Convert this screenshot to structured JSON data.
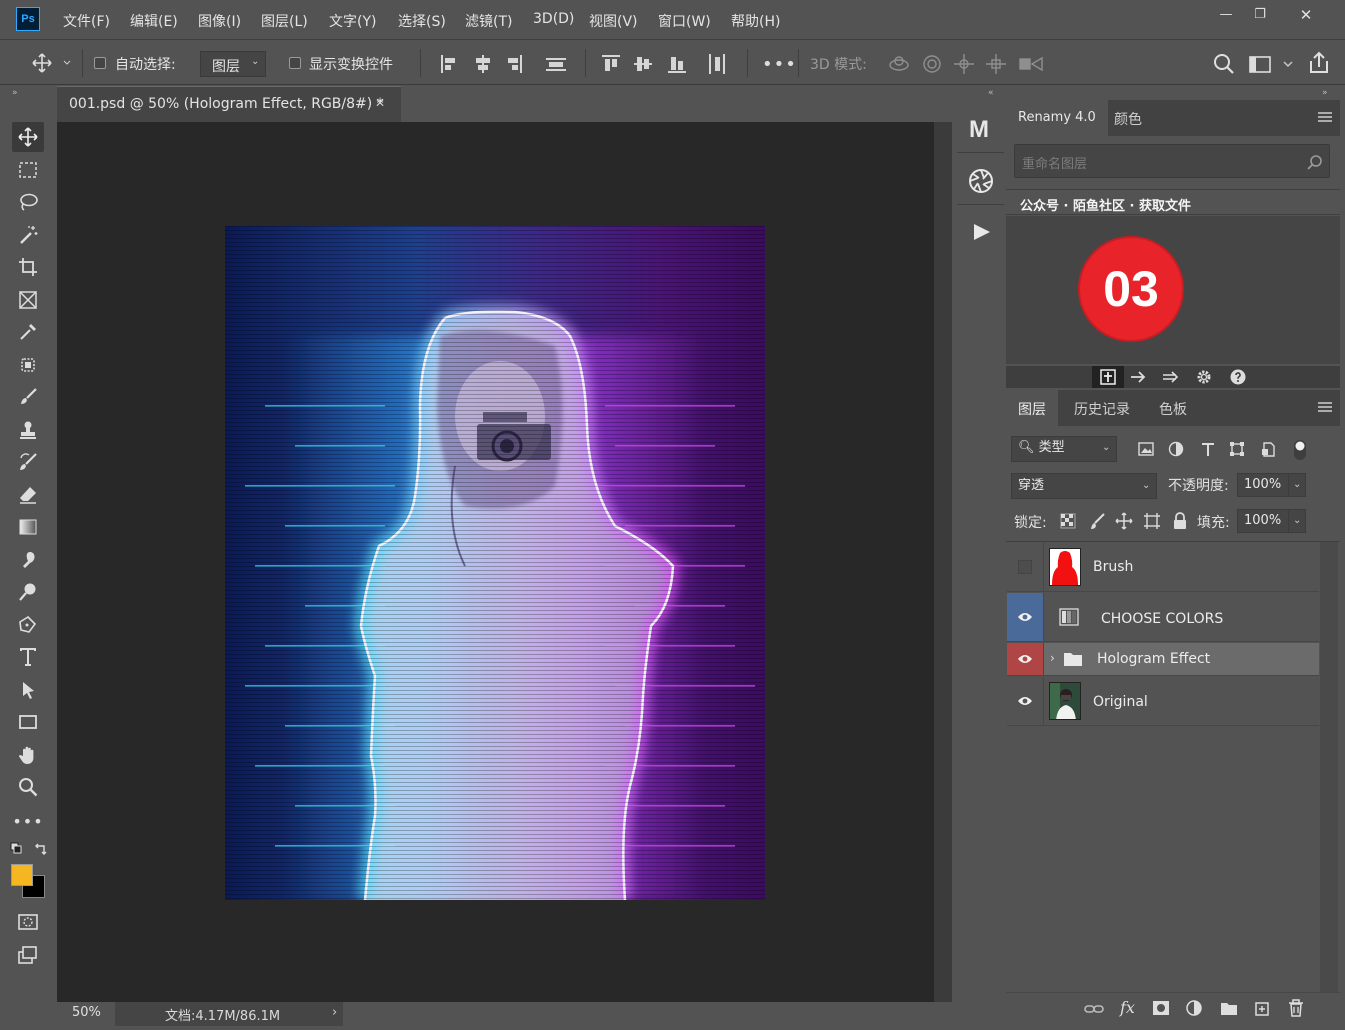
{
  "app": {
    "logo": "Ps"
  },
  "menu": [
    "文件(F)",
    "编辑(E)",
    "图像(I)",
    "图层(L)",
    "文字(Y)",
    "选择(S)",
    "滤镜(T)",
    "3D(D)",
    "视图(V)",
    "窗口(W)",
    "帮助(H)"
  ],
  "window_controls": {
    "minimize": "—",
    "restore": "❐",
    "close": "✕"
  },
  "options_bar": {
    "auto_select_label": "自动选择:",
    "auto_select_target": "图层",
    "show_transform_label": "显示变换控件",
    "mode_3d_label": "3D 模式:"
  },
  "document": {
    "tab_title": "001.psd @ 50% (Hologram Effect, RGB/8#) *",
    "close": "✕",
    "zoom": "50%",
    "doc_info": "文档:4.17M/86.1M"
  },
  "renamy_panel": {
    "tabs": [
      "Renamy 4.0",
      "颜色"
    ],
    "search_placeholder": "重命名图层",
    "banner": "公众号 · 陌鱼社区 · 获取文件",
    "badge_number": "03",
    "badge_color": "#e8232a"
  },
  "layers_panel": {
    "tabs": [
      "图层",
      "历史记录",
      "色板"
    ],
    "filter_kind": "类型",
    "blend_mode": "穿透",
    "opacity_label": "不透明度:",
    "opacity_value": "100%",
    "lock_label": "锁定:",
    "fill_label": "填充:",
    "fill_value": "100%",
    "layers": [
      {
        "name": "Brush",
        "visible": false
      },
      {
        "name": "CHOOSE COLORS",
        "visible": true,
        "selected": true
      },
      {
        "name": "Hologram Effect",
        "visible": true,
        "group": true,
        "expander": "›"
      },
      {
        "name": "Original",
        "visible": true
      }
    ]
  },
  "colors": {
    "foreground": "#f4b621",
    "background": "#000000",
    "eye_blue_bg": "#4a6a99",
    "eye_red_bg": "#b04545"
  },
  "midstrip_logo": "M",
  "footer_icons": [
    "link-icon",
    "fx-icon",
    "mask-icon",
    "adjustment-icon",
    "folder-icon",
    "new-layer-icon",
    "trash-icon"
  ],
  "fx_label": "fx"
}
